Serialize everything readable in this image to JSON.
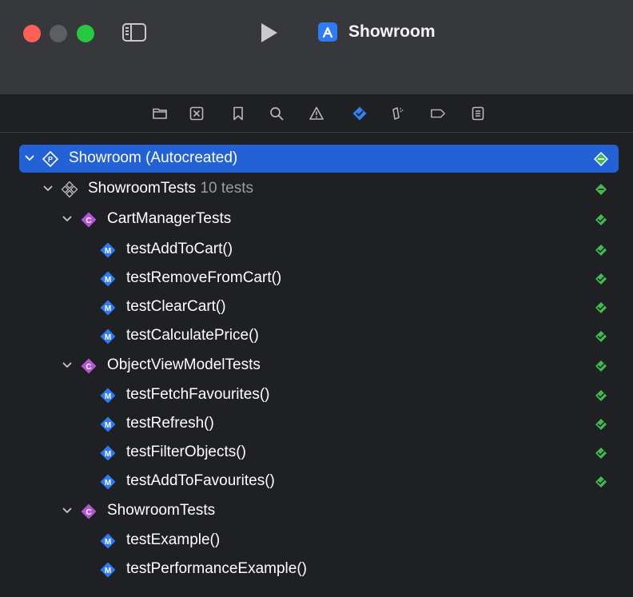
{
  "window": {
    "title": "Showroom"
  },
  "colors": {
    "accent": "#2261d6",
    "pass": "#3fbd52",
    "class_badge": "#b455d7",
    "method_badge": "#2f7bf5"
  },
  "navigator_icons": [
    "folder-icon",
    "source-control-icon",
    "bookmark-icon",
    "search-icon",
    "warning-icon",
    "test-navigator-icon",
    "debug-icon",
    "breakpoint-icon",
    "report-icon"
  ],
  "tree": {
    "root": {
      "label": "Showroom (Autocreated)"
    },
    "target": {
      "label": "ShowroomTests",
      "count": "10 tests"
    },
    "groups": [
      {
        "label": "CartManagerTests",
        "methods": [
          "testAddToCart()",
          "testRemoveFromCart()",
          "testClearCart()",
          "testCalculatePrice()"
        ]
      },
      {
        "label": "ObjectViewModelTests",
        "methods": [
          "testFetchFavourites()",
          "testRefresh()",
          "testFilterObjects()",
          "testAddToFavourites()"
        ]
      },
      {
        "label": "ShowroomTests",
        "methods": [
          "testExample()",
          "testPerformanceExample()"
        ]
      }
    ],
    "badges": {
      "class": "C",
      "method": "M"
    }
  }
}
